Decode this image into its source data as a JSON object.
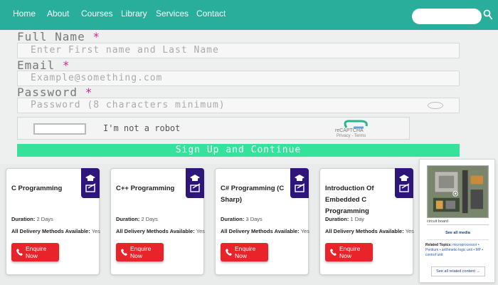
{
  "nav": {
    "items": [
      "Home",
      "About",
      "Courses",
      "Library",
      "Services",
      "Contact"
    ],
    "search_placeholder": "",
    "bg_color": "#28ae9b"
  },
  "form": {
    "full_name_label": "Full Name",
    "full_name_placeholder": "Enter First name and Last Name",
    "email_label": "Email",
    "email_placeholder": "Example@something.com",
    "password_label": "Password",
    "password_placeholder": "Password (8 characters minimum)",
    "required_mark": "*",
    "captcha_label": "I'm not a robot",
    "captcha_brand": "reCAPTCHA",
    "captcha_links": "Privacy - Terms",
    "submit_label": "Sign Up and Continue",
    "submit_color": "#35e29c"
  },
  "courses": [
    {
      "title": "C Programming",
      "duration_label": "Duration:",
      "duration": "2 Days",
      "delivery_label": "All Delivery Methods Available:",
      "delivery": "Yes",
      "button": "Enquire Now"
    },
    {
      "title": "C++ Programming",
      "duration_label": "Duration:",
      "duration": "2 Days",
      "delivery_label": "All Delivery Methods Available:",
      "delivery": "Yes",
      "button": "Enquire Now"
    },
    {
      "title": "C# Programming (C Sharp)",
      "duration_label": "Duration:",
      "duration": "3 Days",
      "delivery_label": "All Delivery Methods Available:",
      "delivery": "Yes",
      "button": "Enquire Now"
    },
    {
      "title": "Introduction Of Embedded C Programming",
      "duration_label": "Duration:",
      "duration": "1 Day",
      "delivery_label": "All Delivery Methods Available:",
      "delivery": "Yes",
      "button": "Enquire Now"
    }
  ],
  "card_colors": {
    "badge": "#2d1579",
    "button": "#e8242b"
  },
  "sidebar": {
    "image_caption": "circuit board",
    "see_all_media": "See all media",
    "related_label": "Related Topics:",
    "related_topics": "microprocessor • Pentium • arithmetic-logic unit • MP • control unit",
    "see_all_related": "See all related content →"
  }
}
